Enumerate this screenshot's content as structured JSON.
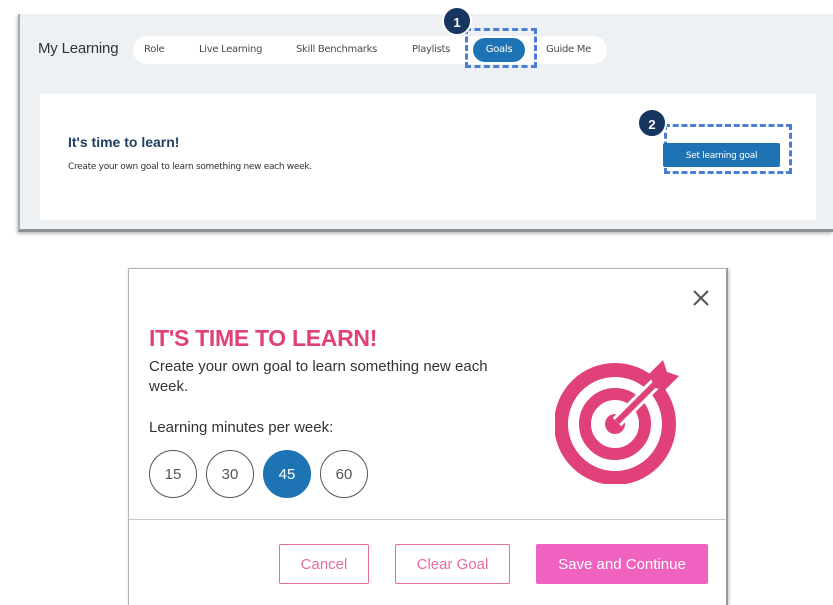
{
  "top": {
    "app_title": "My Learning",
    "tabs": [
      {
        "label": "Role"
      },
      {
        "label": "Live Learning"
      },
      {
        "label": "Skill Benchmarks"
      },
      {
        "label": "Playlists"
      },
      {
        "label": "Goals",
        "active": true
      },
      {
        "label": "Guide Me"
      }
    ],
    "callouts": [
      "1",
      "2"
    ],
    "card": {
      "title": "It's time to learn!",
      "subtitle": "Create your own goal to learn something new each week.",
      "button_label": "Set learning goal"
    }
  },
  "modal": {
    "close_icon": "close-icon",
    "title": "IT'S TIME TO LEARN!",
    "description": "Create your own goal to learn something new each week.",
    "minutes_label": "Learning minutes per week:",
    "minute_options": [
      "15",
      "30",
      "45",
      "60"
    ],
    "selected_minutes": "45",
    "target_icon": "target-icon",
    "buttons": {
      "cancel": "Cancel",
      "clear": "Clear Goal",
      "save": "Save and Continue"
    }
  },
  "colors": {
    "primary_blue": "#1d73b4",
    "title_pink": "#e0417a",
    "button_pink": "#f062c0",
    "callout_navy": "#16355f",
    "highlight_dash": "#4a7dd6"
  }
}
